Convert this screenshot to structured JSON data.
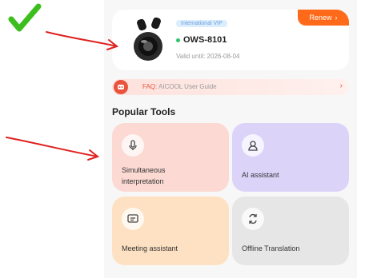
{
  "vip_card": {
    "renew_label": "Renew",
    "badge": "International VIP",
    "device_name": "OWS-8101",
    "valid_until": "Valid until: 2026-08-04"
  },
  "faq": {
    "prefix": "FAQ:",
    "text": "AICOOL User Guide"
  },
  "tools": {
    "title": "Popular Tools",
    "items": [
      {
        "label_line1": "Simultaneous",
        "label_line2": "interpretation",
        "icon": "microphone-icon",
        "color": "#fcd9d3"
      },
      {
        "label_line1": "AI assistant",
        "label_line2": "",
        "icon": "robot-icon",
        "color": "#dcd3f9"
      },
      {
        "label_line1": "Meeting assistant",
        "label_line2": "",
        "icon": "meeting-icon",
        "color": "#fde1c2"
      },
      {
        "label_line1": "Offline Translation",
        "label_line2": "",
        "icon": "sync-icon",
        "color": "#e6e6e6"
      }
    ]
  },
  "colors": {
    "accent_orange": "#ff6a1a",
    "status_green": "#2cc56a",
    "annotation_red": "#e02020",
    "checkmark_green": "#3cbf1e"
  }
}
